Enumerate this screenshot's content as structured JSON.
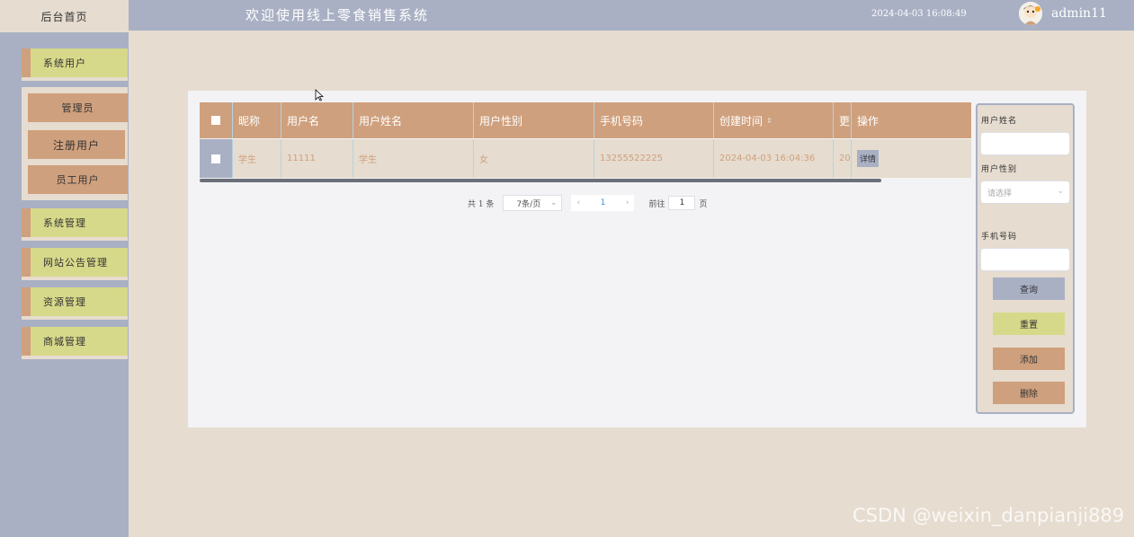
{
  "nav": {
    "home": "后台首页"
  },
  "header": {
    "title": "欢迎使用线上零食销售系统",
    "time": "2024-04-03 16:08:49",
    "username": "admin11",
    "avatar_icon": "user-avatar-icon"
  },
  "sidebar": {
    "items": [
      {
        "label": "系统用户"
      },
      {
        "label": "系统管理"
      },
      {
        "label": "网站公告管理"
      },
      {
        "label": "资源管理"
      },
      {
        "label": "商城管理"
      }
    ],
    "submenu": [
      {
        "label": "管理员"
      },
      {
        "label": "注册用户"
      },
      {
        "label": "员工用户"
      }
    ]
  },
  "table": {
    "headers": [
      "昵称",
      "用户名",
      "用户姓名",
      "用户性别",
      "手机号码",
      "创建时间",
      "更",
      "操作"
    ],
    "rows": [
      {
        "nickname": "学生",
        "username": "11111",
        "realname": "学生",
        "gender": "女",
        "phone": "13255522225",
        "created": "2024-04-03 16:04:36",
        "updated": "20",
        "action": "详情"
      }
    ]
  },
  "pager": {
    "total": "共 1 条",
    "page_size": "7条/页",
    "current": "1",
    "goto_label": "前往",
    "goto_value": "1",
    "page_unit": "页"
  },
  "search": {
    "name_label": "用户姓名",
    "gender_label": "用户性别",
    "gender_placeholder": "请选择",
    "phone_label": "手机号码",
    "query": "查询",
    "reset": "重置",
    "add": "添加",
    "delete": "删除"
  },
  "watermark": "CSDN @weixin_danpianji889",
  "colors": {
    "sidebar": "#a9b0c4",
    "header": "#a9b0c4",
    "menu": "#d7d98a",
    "accent": "#cfa07d",
    "bg": "#e6dccf"
  }
}
